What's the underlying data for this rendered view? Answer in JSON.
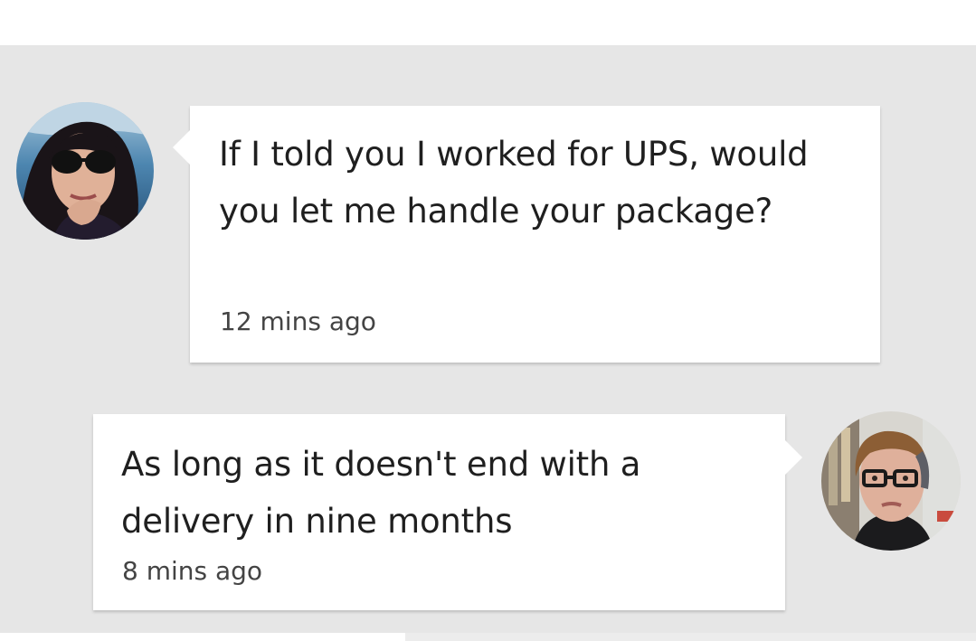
{
  "messages": [
    {
      "sender": "left",
      "text": "If I told you I worked for UPS, would you let me handle your package?",
      "time": "12 mins ago"
    },
    {
      "sender": "right",
      "text": "As long as it doesn't end with a delivery in nine months",
      "time": "8 mins ago"
    }
  ],
  "colors": {
    "background": "#e6e6e6",
    "bubble": "#ffffff",
    "text": "#1f1f1f",
    "timestamp": "#444444"
  },
  "icons": {
    "left_avatar": "woman-with-sunglasses-avatar",
    "right_avatar": "man-with-glasses-avatar"
  }
}
